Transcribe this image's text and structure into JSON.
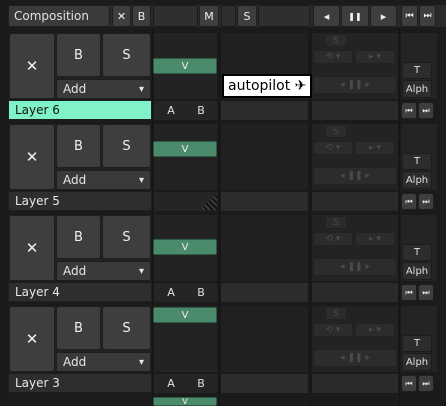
{
  "header": {
    "title": "Composition",
    "close_label": "✕",
    "bypass_label": "B",
    "mute_label": "M",
    "solo_label": "S",
    "transport_prev": "◂",
    "transport_pause": "❚❚",
    "transport_next": "▸",
    "transport_skip_back": "⏮",
    "transport_skip_fwd": "⏭"
  },
  "tooltip": {
    "text": "autopilot ✈"
  },
  "layers": [
    {
      "name": "Layer 6",
      "selected": true,
      "close": "✕",
      "bypass": "B",
      "solo": "S",
      "add": "Add",
      "video": "V",
      "a": "A",
      "b": "B",
      "t": "T",
      "alpha": "Alph"
    },
    {
      "name": "Layer 5",
      "selected": false,
      "close": "✕",
      "bypass": "B",
      "solo": "S",
      "add": "Add",
      "video": "V",
      "a": "",
      "b": "",
      "t": "T",
      "alpha": "Alph"
    },
    {
      "name": "Layer 4",
      "selected": false,
      "close": "✕",
      "bypass": "B",
      "solo": "S",
      "add": "Add",
      "video": "V",
      "a": "A",
      "b": "B",
      "t": "T",
      "alpha": "Alph"
    },
    {
      "name": "Layer 3",
      "selected": false,
      "close": "✕",
      "bypass": "B",
      "solo": "S",
      "add": "Add",
      "video": "V",
      "a": "A",
      "b": "B",
      "t": "T",
      "alpha": "Alph"
    }
  ],
  "next_layer_video": "V",
  "dropdown_arrow": "▾",
  "colors": {
    "selected_layer": "#7ff3c7",
    "video_button": "#4b8a6b"
  }
}
